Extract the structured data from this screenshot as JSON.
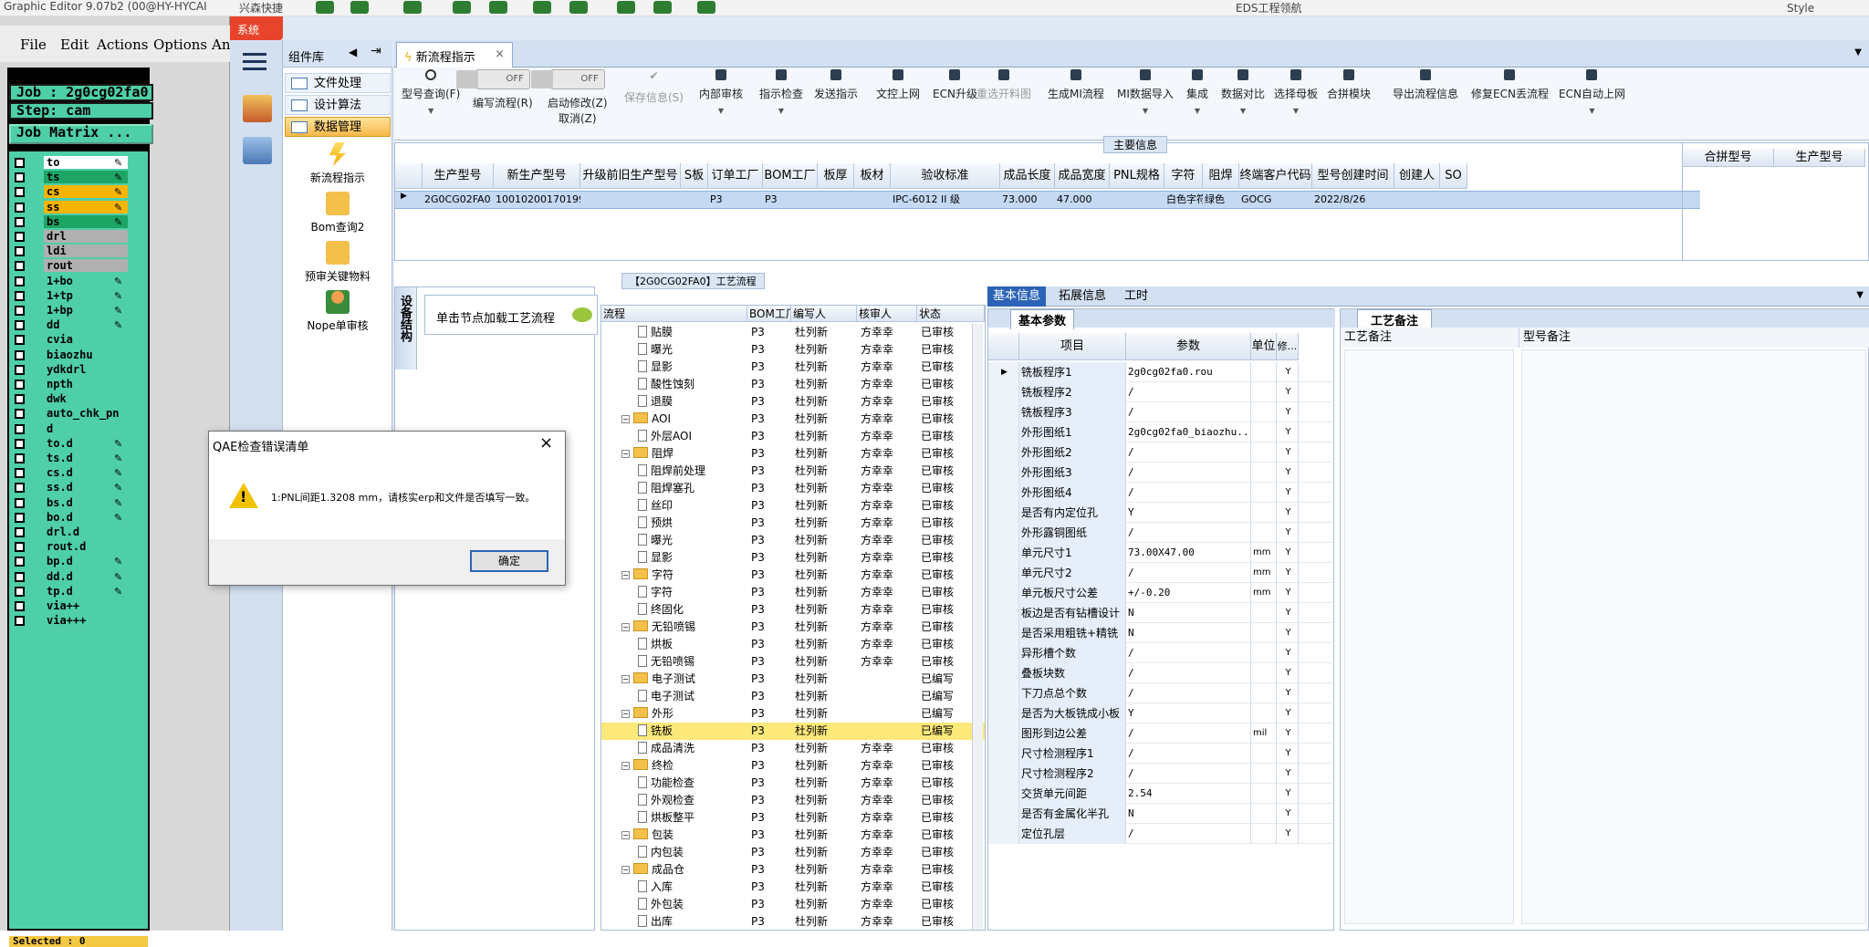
{
  "top": {
    "genesis_title": "Graphic Editor 9.07b2 (00@HY-HYCAI",
    "app_quick": "兴森快捷",
    "app_title": "EDS工程领航",
    "style_label": "Style"
  },
  "genesis": {
    "menu": [
      "File",
      "Edit",
      "Actions",
      "Options",
      "An"
    ],
    "job": "Job : 2g0cg02fa0",
    "step": "Step: cam",
    "matrix": "Job Matrix ...",
    "layers": [
      {
        "name": "to",
        "color": "#ffffff",
        "pen": true
      },
      {
        "name": "ts",
        "color": "#1da566",
        "pen": true
      },
      {
        "name": "cs",
        "color": "#f5b400",
        "pen": true
      },
      {
        "name": "ss",
        "color": "#f5b400",
        "pen": true
      },
      {
        "name": "bs",
        "color": "#1da566",
        "pen": true
      },
      {
        "name": "drl",
        "color": "#b0b0b0",
        "pen": false
      },
      {
        "name": "ldi",
        "color": "#b0b0b0",
        "pen": false
      },
      {
        "name": "rout",
        "color": "#b0b0b0",
        "pen": false
      },
      {
        "name": "1+bo",
        "color": "#4ecfa8",
        "pen": true
      },
      {
        "name": "1+tp",
        "color": "#4ecfa8",
        "pen": true
      },
      {
        "name": "1+bp",
        "color": "#4ecfa8",
        "pen": true
      },
      {
        "name": "dd",
        "color": "#4ecfa8",
        "pen": true
      },
      {
        "name": "cvia",
        "color": "#4ecfa8",
        "pen": false
      },
      {
        "name": "biaozhu",
        "color": "#4ecfa8",
        "pen": false
      },
      {
        "name": "ydkdrl",
        "color": "#4ecfa8",
        "pen": false
      },
      {
        "name": "npth",
        "color": "#4ecfa8",
        "pen": false
      },
      {
        "name": "dwk",
        "color": "#4ecfa8",
        "pen": false
      },
      {
        "name": "auto_chk_pn",
        "color": "#4ecfa8",
        "pen": false
      },
      {
        "name": "d",
        "color": "#4ecfa8",
        "pen": false
      },
      {
        "name": "to.d",
        "color": "#4ecfa8",
        "pen": true
      },
      {
        "name": "ts.d",
        "color": "#4ecfa8",
        "pen": true
      },
      {
        "name": "cs.d",
        "color": "#4ecfa8",
        "pen": true
      },
      {
        "name": "ss.d",
        "color": "#4ecfa8",
        "pen": true
      },
      {
        "name": "bs.d",
        "color": "#4ecfa8",
        "pen": true
      },
      {
        "name": "bo.d",
        "color": "#4ecfa8",
        "pen": true
      },
      {
        "name": "drl.d",
        "color": "#4ecfa8",
        "pen": false
      },
      {
        "name": "rout.d",
        "color": "#4ecfa8",
        "pen": false
      },
      {
        "name": "bp.d",
        "color": "#4ecfa8",
        "pen": true
      },
      {
        "name": "dd.d",
        "color": "#4ecfa8",
        "pen": true
      },
      {
        "name": "tp.d",
        "color": "#4ecfa8",
        "pen": true
      },
      {
        "name": "via++",
        "color": "#4ecfa8",
        "pen": false
      },
      {
        "name": "via+++",
        "color": "#4ecfa8",
        "pen": false
      }
    ],
    "selected": "Selected : 0"
  },
  "sys_label": "系统",
  "component": {
    "header": "组件库",
    "items": [
      "文件处理",
      "设计算法",
      "数据管理"
    ],
    "big": [
      "新流程指示",
      "Bom查询2",
      "预审关键物料",
      "Nope单审核"
    ]
  },
  "tab": "新流程指示",
  "toolbar": {
    "query": "型号查询(F)",
    "toggle_off": "OFF",
    "edit_flow": "编写流程(R)",
    "start_change": "启动修改(Z)",
    "cancel": "取消(Z)",
    "save": "保存信息(S)",
    "buttons": [
      "内部审核",
      "指示检查",
      "发送指示",
      "文控上网",
      "ECN升级",
      "重选开料图",
      "生成MI流程",
      "MI数据导入",
      "集成",
      "数据对比",
      "选择母板",
      "合拼模块",
      "导出流程信息",
      "修复ECN丢流程",
      "ECN自动上网"
    ]
  },
  "main_info": {
    "caption": "主要信息",
    "columns": [
      "生产型号",
      "新生产型号",
      "升级前旧生产型号",
      "S板",
      "订单工厂",
      "BOM工厂",
      "板厚",
      "板材",
      "验收标准",
      "成品长度",
      "成品宽度",
      "PNL规格",
      "字符",
      "阻焊",
      "终端客户代码",
      "型号创建时间",
      "创建人",
      "SO"
    ],
    "row": [
      "2G0CG02FA0",
      "10010200170199",
      "",
      "",
      "P3",
      "P3",
      "",
      "",
      "IPC-6012 II 级",
      "73.000",
      "47.000",
      "",
      "白色字符",
      "绿色",
      "GOCG",
      "2022/8/26",
      "",
      ""
    ],
    "right_columns": [
      "合拼型号",
      "生产型号"
    ]
  },
  "flow": {
    "caption": "【2G0CG02FA0】工艺流程",
    "side_tab": "设备结构",
    "node_text": "单击节点加载工艺流程",
    "columns": [
      "流程",
      "BOM工厂",
      "编写人",
      "核审人",
      "状态"
    ],
    "rows": [
      {
        "lvl": 2,
        "t": "doc",
        "name": "贴膜",
        "f": "P3",
        "w": "杜列新",
        "r": "方幸幸",
        "s": "已审核"
      },
      {
        "lvl": 2,
        "t": "doc",
        "name": "曝光",
        "f": "P3",
        "w": "杜列新",
        "r": "方幸幸",
        "s": "已审核"
      },
      {
        "lvl": 2,
        "t": "doc",
        "name": "显影",
        "f": "P3",
        "w": "杜列新",
        "r": "方幸幸",
        "s": "已审核"
      },
      {
        "lvl": 2,
        "t": "doc",
        "name": "酸性蚀刻",
        "f": "P3",
        "w": "杜列新",
        "r": "方幸幸",
        "s": "已审核"
      },
      {
        "lvl": 2,
        "t": "doc",
        "name": "退膜",
        "f": "P3",
        "w": "杜列新",
        "r": "方幸幸",
        "s": "已审核"
      },
      {
        "lvl": 1,
        "t": "fold",
        "name": "AOI",
        "f": "P3",
        "w": "杜列新",
        "r": "方幸幸",
        "s": "已审核"
      },
      {
        "lvl": 2,
        "t": "doc",
        "name": "外层AOI",
        "f": "P3",
        "w": "杜列新",
        "r": "方幸幸",
        "s": "已审核"
      },
      {
        "lvl": 1,
        "t": "fold",
        "name": "阻焊",
        "f": "P3",
        "w": "杜列新",
        "r": "方幸幸",
        "s": "已审核"
      },
      {
        "lvl": 2,
        "t": "doc",
        "name": "阻焊前处理",
        "f": "P3",
        "w": "杜列新",
        "r": "方幸幸",
        "s": "已审核"
      },
      {
        "lvl": 2,
        "t": "doc",
        "name": "阻焊塞孔",
        "f": "P3",
        "w": "杜列新",
        "r": "方幸幸",
        "s": "已审核"
      },
      {
        "lvl": 2,
        "t": "doc",
        "name": "丝印",
        "f": "P3",
        "w": "杜列新",
        "r": "方幸幸",
        "s": "已审核"
      },
      {
        "lvl": 2,
        "t": "doc",
        "name": "预烘",
        "f": "P3",
        "w": "杜列新",
        "r": "方幸幸",
        "s": "已审核"
      },
      {
        "lvl": 2,
        "t": "doc",
        "name": "曝光",
        "f": "P3",
        "w": "杜列新",
        "r": "方幸幸",
        "s": "已审核"
      },
      {
        "lvl": 2,
        "t": "doc",
        "name": "显影",
        "f": "P3",
        "w": "杜列新",
        "r": "方幸幸",
        "s": "已审核"
      },
      {
        "lvl": 1,
        "t": "fold",
        "name": "字符",
        "f": "P3",
        "w": "杜列新",
        "r": "方幸幸",
        "s": "已审核"
      },
      {
        "lvl": 2,
        "t": "doc",
        "name": "字符",
        "f": "P3",
        "w": "杜列新",
        "r": "方幸幸",
        "s": "已审核"
      },
      {
        "lvl": 2,
        "t": "doc",
        "name": "终固化",
        "f": "P3",
        "w": "杜列新",
        "r": "方幸幸",
        "s": "已审核"
      },
      {
        "lvl": 1,
        "t": "fold",
        "name": "无铅喷锡",
        "f": "P3",
        "w": "杜列新",
        "r": "方幸幸",
        "s": "已审核"
      },
      {
        "lvl": 2,
        "t": "doc",
        "name": "烘板",
        "f": "P3",
        "w": "杜列新",
        "r": "方幸幸",
        "s": "已审核"
      },
      {
        "lvl": 2,
        "t": "doc",
        "name": "无铅喷锡",
        "f": "P3",
        "w": "杜列新",
        "r": "方幸幸",
        "s": "已审核"
      },
      {
        "lvl": 1,
        "t": "fold",
        "name": "电子测试",
        "f": "P3",
        "w": "杜列新",
        "r": "",
        "s": "已编写"
      },
      {
        "lvl": 2,
        "t": "doc",
        "name": "电子测试",
        "f": "P3",
        "w": "杜列新",
        "r": "",
        "s": "已编写"
      },
      {
        "lvl": 1,
        "t": "fold",
        "name": "外形",
        "f": "P3",
        "w": "杜列新",
        "r": "",
        "s": "已编写"
      },
      {
        "lvl": 2,
        "t": "doc",
        "name": "铣板",
        "f": "P3",
        "w": "杜列新",
        "r": "",
        "s": "已编写",
        "sel": true
      },
      {
        "lvl": 2,
        "t": "doc",
        "name": "成品清洗",
        "f": "P3",
        "w": "杜列新",
        "r": "方幸幸",
        "s": "已审核"
      },
      {
        "lvl": 1,
        "t": "fold",
        "name": "终检",
        "f": "P3",
        "w": "杜列新",
        "r": "方幸幸",
        "s": "已审核"
      },
      {
        "lvl": 2,
        "t": "doc",
        "name": "功能检查",
        "f": "P3",
        "w": "杜列新",
        "r": "方幸幸",
        "s": "已审核"
      },
      {
        "lvl": 2,
        "t": "doc",
        "name": "外观检查",
        "f": "P3",
        "w": "杜列新",
        "r": "方幸幸",
        "s": "已审核"
      },
      {
        "lvl": 2,
        "t": "doc",
        "name": "烘板整平",
        "f": "P3",
        "w": "杜列新",
        "r": "方幸幸",
        "s": "已审核"
      },
      {
        "lvl": 1,
        "t": "fold",
        "name": "包装",
        "f": "P3",
        "w": "杜列新",
        "r": "方幸幸",
        "s": "已审核"
      },
      {
        "lvl": 2,
        "t": "doc",
        "name": "内包装",
        "f": "P3",
        "w": "杜列新",
        "r": "方幸幸",
        "s": "已审核"
      },
      {
        "lvl": 1,
        "t": "fold",
        "name": "成品仓",
        "f": "P3",
        "w": "杜列新",
        "r": "方幸幸",
        "s": "已审核"
      },
      {
        "lvl": 2,
        "t": "doc",
        "name": "入库",
        "f": "P3",
        "w": "杜列新",
        "r": "方幸幸",
        "s": "已审核"
      },
      {
        "lvl": 2,
        "t": "doc",
        "name": "外包装",
        "f": "P3",
        "w": "杜列新",
        "r": "方幸幸",
        "s": "已审核"
      },
      {
        "lvl": 2,
        "t": "doc",
        "name": "出库",
        "f": "P3",
        "w": "杜列新",
        "r": "方幸幸",
        "s": "已审核"
      }
    ]
  },
  "basic": {
    "tabs": [
      "基本信息",
      "拓展信息",
      "工时"
    ],
    "param_caption": "基本参数",
    "columns": [
      "项目",
      "参数",
      "单位",
      "修..."
    ],
    "rows": [
      [
        "铣板程序1",
        "2g0cg02fa0.rou",
        "",
        "Y"
      ],
      [
        "铣板程序2",
        "/",
        "",
        "Y"
      ],
      [
        "铣板程序3",
        "/",
        "",
        "Y"
      ],
      [
        "外形图纸1",
        "2g0cg02fa0_biaozhu...",
        "",
        "Y"
      ],
      [
        "外形图纸2",
        "/",
        "",
        "Y"
      ],
      [
        "外形图纸3",
        "/",
        "",
        "Y"
      ],
      [
        "外形图纸4",
        "/",
        "",
        "Y"
      ],
      [
        "是否有内定位孔",
        "Y",
        "",
        "Y"
      ],
      [
        "外形露铜图纸",
        "/",
        "",
        "Y"
      ],
      [
        "单元尺寸1",
        "73.00X47.00",
        "mm",
        "Y"
      ],
      [
        "单元尺寸2",
        "/",
        "mm",
        "Y"
      ],
      [
        "单元板尺寸公差",
        "+/-0.20",
        "mm",
        "Y"
      ],
      [
        "板边是否有钻槽设计",
        "N",
        "",
        "Y"
      ],
      [
        "是否采用粗铣+精铣",
        "N",
        "",
        "Y"
      ],
      [
        "异形槽个数",
        "/",
        "",
        "Y"
      ],
      [
        "叠板块数",
        "/",
        "",
        "Y"
      ],
      [
        "下刀点总个数",
        "/",
        "",
        "Y"
      ],
      [
        "是否为大板铣成小板",
        "Y",
        "",
        "Y"
      ],
      [
        "图形到边公差",
        "/",
        "mil",
        "Y"
      ],
      [
        "尺寸检测程序1",
        "/",
        "",
        "Y"
      ],
      [
        "尺寸检测程序2",
        "/",
        "",
        "Y"
      ],
      [
        "交货单元间距",
        "2.54",
        "",
        "Y"
      ],
      [
        "是否有金属化半孔",
        "N",
        "",
        "Y"
      ],
      [
        "定位孔层",
        "/",
        "",
        "Y"
      ]
    ],
    "remark_caption": "工艺备注",
    "remark_columns": [
      "工艺备注",
      "型号备注"
    ]
  },
  "dialog": {
    "title": "QAE检查错误清单",
    "message": "1:PNL间距1.3208 mm，请核实erp和文件是否填写一致。",
    "ok": "确定"
  }
}
